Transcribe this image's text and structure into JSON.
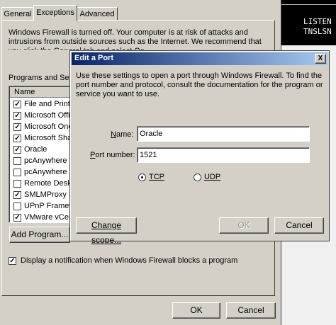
{
  "firewall": {
    "tabs": [
      "General",
      "Exceptions",
      "Advanced"
    ],
    "warning_text": "Windows Firewall is turned off. Your computer is at risk of attacks and intrusions from outside sources such as the Internet. We recommend that you click the General tab and select On.",
    "programs_label": "Programs and Serv",
    "list_header": "Name",
    "items": [
      {
        "label": "File and Printe",
        "checked": true
      },
      {
        "label": "Microsoft Offic",
        "checked": true
      },
      {
        "label": "Microsoft One",
        "checked": true
      },
      {
        "label": "Microsoft Shar",
        "checked": true
      },
      {
        "label": "Oracle",
        "checked": true
      },
      {
        "label": "pcAnywhere H",
        "checked": false
      },
      {
        "label": "pcAnywhere F",
        "checked": false
      },
      {
        "label": "Remote Deskt",
        "checked": false
      },
      {
        "label": "SMLMProxy M",
        "checked": true
      },
      {
        "label": "UPnP Framew",
        "checked": false
      },
      {
        "label": "VMware vCen",
        "checked": true
      }
    ],
    "add_program_label": "Add Program...",
    "notify_label": "Display a notification when Windows Firewall blocks a program",
    "notify_checked": true,
    "ok_label": "OK",
    "cancel_label": "Cancel"
  },
  "terminal": {
    "lines": [
      "LISTEN",
      "TNSLSN"
    ]
  },
  "edit_port": {
    "title": "Edit a Port",
    "close_label": "X",
    "description": "Use these settings to open a port through Windows Firewall. To find the port number and protocol, consult the documentation for the program or service you want to use.",
    "name_label": "Name:",
    "name_value": "Oracle",
    "port_label": "Port number:",
    "port_value": "1521",
    "tcp_label": "TCP",
    "udp_label": "UDP",
    "selected_protocol": "TCP",
    "change_scope_label": "Change scope...",
    "ok_label": "OK",
    "cancel_label": "Cancel"
  },
  "colors": {
    "dialog_face": "#d4d0c8",
    "title_active_start": "#0a246a",
    "title_active_end": "#a6caf0",
    "title_inactive": "#808080",
    "terminal_bg": "#000000"
  }
}
